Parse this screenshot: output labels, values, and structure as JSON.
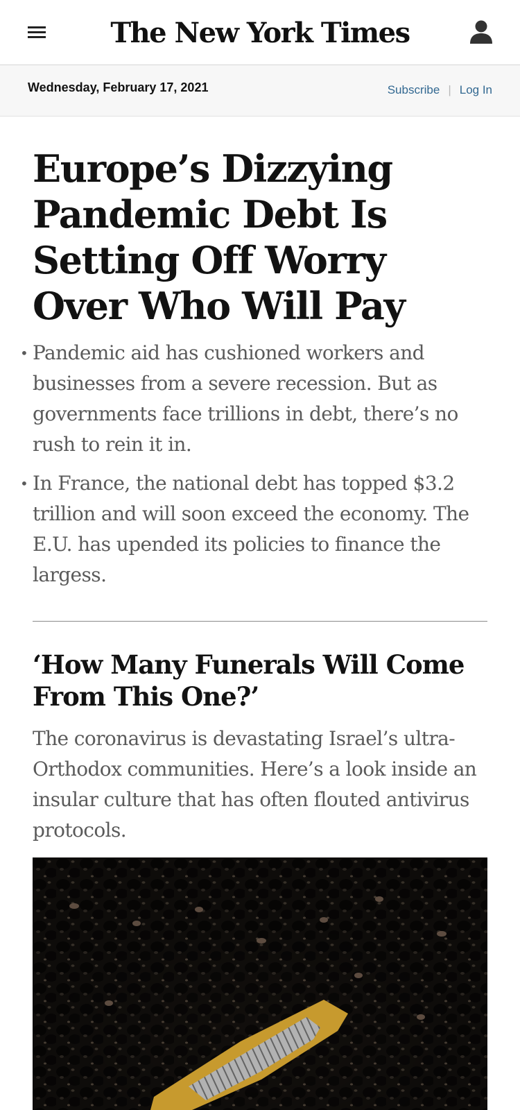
{
  "masthead": {
    "logo_text": "The New York Times",
    "menu_icon": "hamburger-menu-icon",
    "account_icon": "user-account-icon"
  },
  "datebar": {
    "date": "Wednesday, February 17, 2021",
    "subscribe_label": "Subscribe",
    "separator": "|",
    "login_label": "Log In"
  },
  "lead_story": {
    "headline": "Europe’s Dizzying Pandemic Debt Is Setting Off Worry Over Who Will Pay",
    "summary": [
      "Pandemic aid has cushioned workers and businesses from a severe recession. But as governments face trillions in debt, there’s no rush to rein it in.",
      "In France, the national debt has topped $3.2 trillion and will soon exceed the economy. The E.U. has upended its policies to finance the largess."
    ]
  },
  "second_story": {
    "headline": "‘How Many Funerals Will Come From This One?’",
    "summary": "The coronavirus is devastating Israel’s ultra-Orthodox communities. Here’s a look inside an insular culture that has often flouted antivirus protocols."
  },
  "colors": {
    "link": "#326891",
    "text": "#121212",
    "summary_text": "#5a5a5a",
    "datebar_bg": "#f7f7f7"
  }
}
